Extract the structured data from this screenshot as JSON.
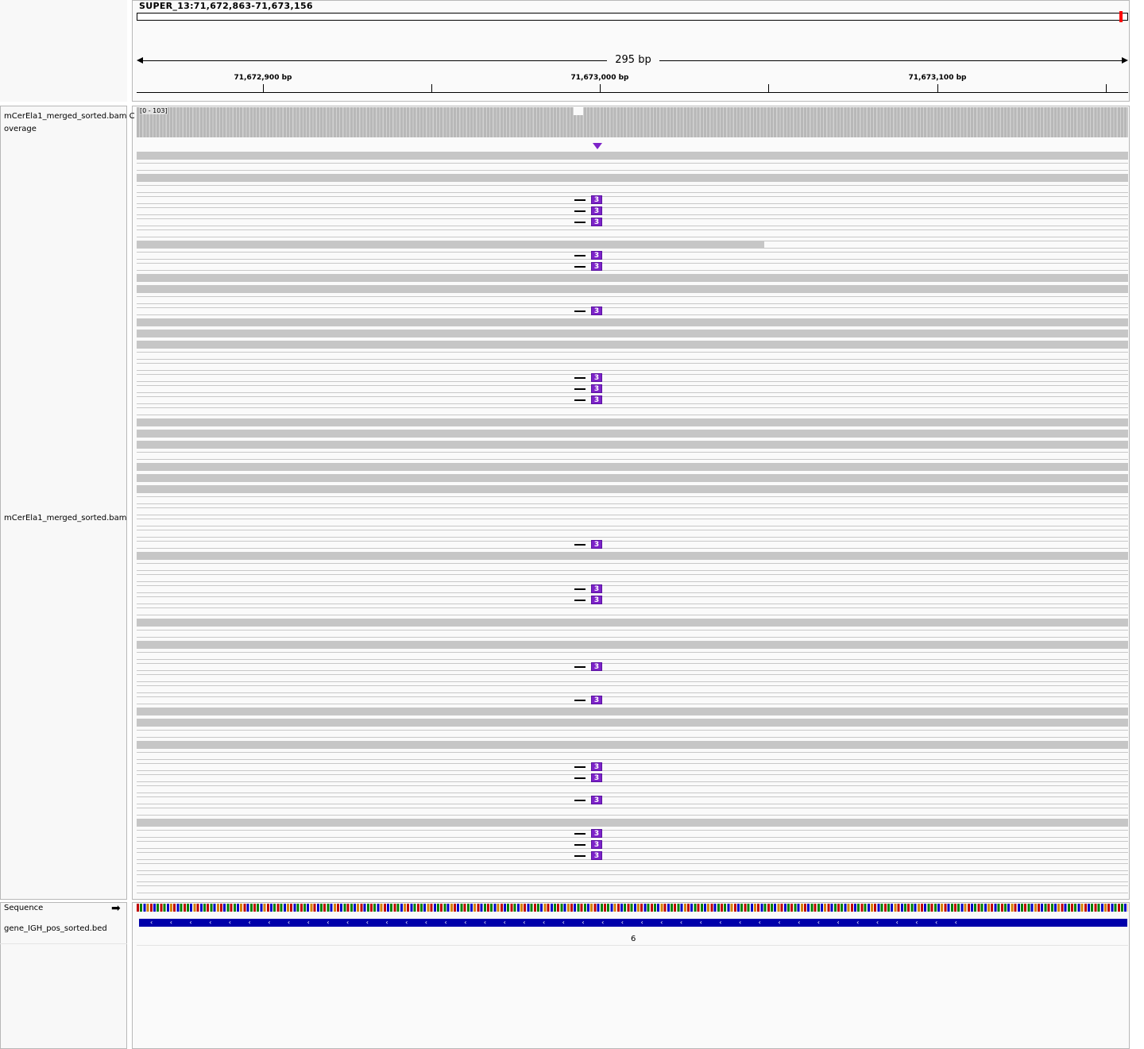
{
  "locus": "SUPER_13:71,672,863-71,673,156",
  "span_label": "295 bp",
  "ruler_ticks": [
    {
      "label": "71,672,900 bp"
    },
    {
      "label": "71,673,000 bp"
    },
    {
      "label": "71,673,100 bp"
    }
  ],
  "tracks": {
    "coverage_name": "mCerEla1_merged_sorted.bam Coverage",
    "coverage_range": "[0 - 103]",
    "alignment_name": "mCerEla1_merged_sorted.bam",
    "sequence_name": "Sequence",
    "bed_name": "gene_IGH_pos_sorted.bed",
    "bed_feature_label": "6"
  },
  "insertion_label": "3",
  "colors": {
    "read_gray": "#c6c6c6",
    "insertion": "#7d23c9",
    "gene_feature": "#0000aa",
    "chrom_marker": "#ff0000"
  },
  "icons": {
    "strand_arrow": "right-arrow-icon",
    "insertion_marker": "down-triangle-icon"
  }
}
